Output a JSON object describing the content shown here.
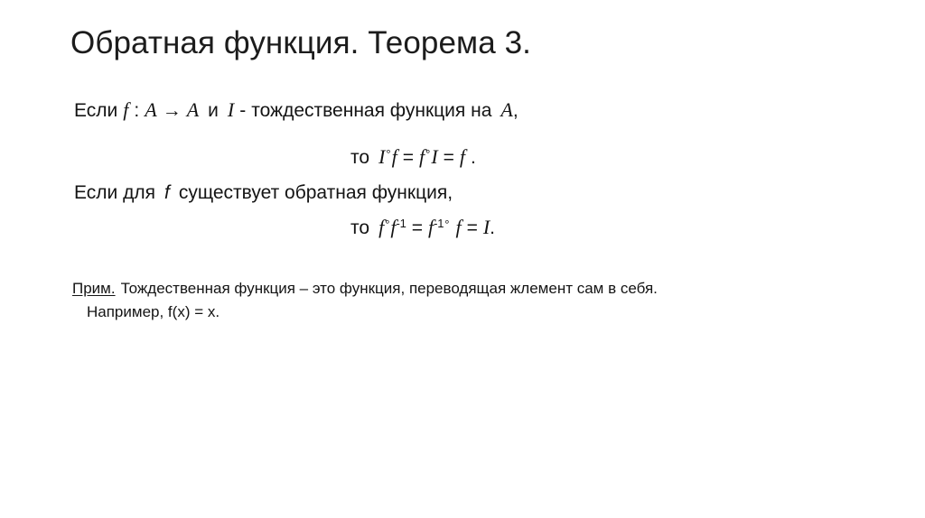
{
  "slide": {
    "title": "Обратная функция. Теорема 3.",
    "background_color": "#ffffff",
    "text_color": "#141414",
    "title_color": "#1c1c1c"
  },
  "body": {
    "line1": {
      "prefix": "Если",
      "func": "f",
      "colon": ":",
      "domain": "A",
      "arrow": "→",
      "codomain": "A",
      "conj": "и",
      "identity": "I",
      "dash": "-",
      "tail": "тождественная функция на",
      "set": "A",
      "comma": ","
    },
    "line2": {
      "then": "то",
      "identity": "I",
      "ring": "°",
      "func": "f",
      "eq1": "=",
      "func2": "f",
      "ring2": "°",
      "identity2": "I",
      "eq2": "=",
      "func3": "f",
      "period": "."
    },
    "line3": {
      "text_before": "Если для",
      "func": "f",
      "text_after": "существует обратная функция,"
    },
    "line4": {
      "then": "то",
      "func": "f",
      "ring": "°",
      "func_inv_base": "f",
      "func_inv_sup": "-1",
      "eq1": "=",
      "func_inv_base2": "f",
      "func_inv_sup2": "-1",
      "ring2": "°",
      "func2": "f",
      "eq2": "=",
      "identity": "I",
      "period": "."
    }
  },
  "note": {
    "label": "Прим.",
    "text": "Тождественная функция – это функция, переводящая жлемент сам в себя.",
    "example": "Например, f(x) = x."
  }
}
